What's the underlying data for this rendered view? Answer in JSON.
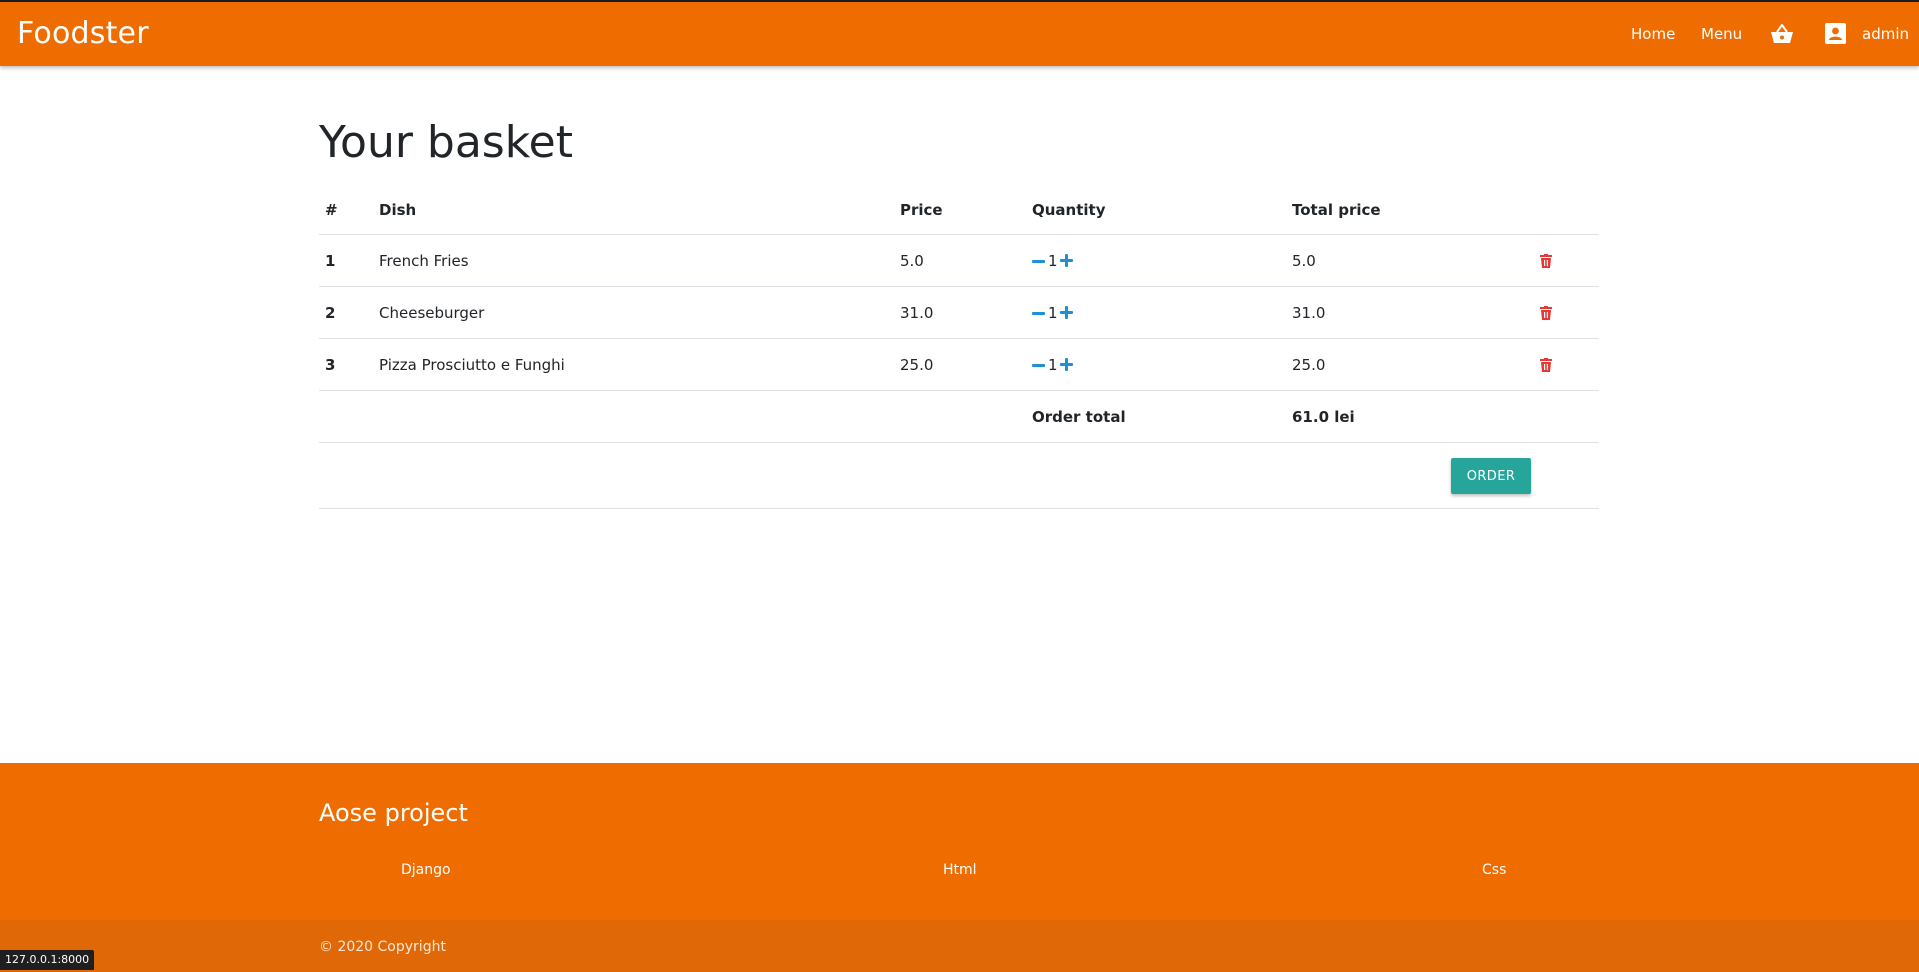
{
  "navbar": {
    "brand": "Foodster",
    "links": {
      "home": "Home",
      "menu": "Menu",
      "user": "admin"
    },
    "color": "#ef6c00"
  },
  "page": {
    "title": "Your basket"
  },
  "table": {
    "headers": {
      "index": "#",
      "dish": "Dish",
      "price": "Price",
      "quantity": "Quantity",
      "total": "Total price"
    },
    "rows": [
      {
        "index": "1",
        "dish": "French Fries",
        "price": "5.0",
        "quantity": "1",
        "total": "5.0"
      },
      {
        "index": "2",
        "dish": "Cheeseburger",
        "price": "31.0",
        "quantity": "1",
        "total": "31.0"
      },
      {
        "index": "3",
        "dish": "Pizza Prosciutto e Funghi",
        "price": "25.0",
        "quantity": "1",
        "total": "25.0"
      }
    ],
    "order_total_label": "Order total",
    "order_total_value": "61.0 lei"
  },
  "order_button": {
    "label": "ORDER",
    "color": "#26a69a"
  },
  "icons": {
    "basket": "basket-icon",
    "user": "account-box-icon",
    "minus": "minus-icon",
    "plus": "plus-icon",
    "delete": "trash-icon",
    "accent": "#1e90d6",
    "delete_color": "#e53935"
  },
  "footer": {
    "title": "Aose project",
    "links": [
      "Django",
      "Html",
      "Css"
    ],
    "copyright": "© 2020 Copyright"
  },
  "status_bar": {
    "url": "127.0.0.1:8000"
  }
}
